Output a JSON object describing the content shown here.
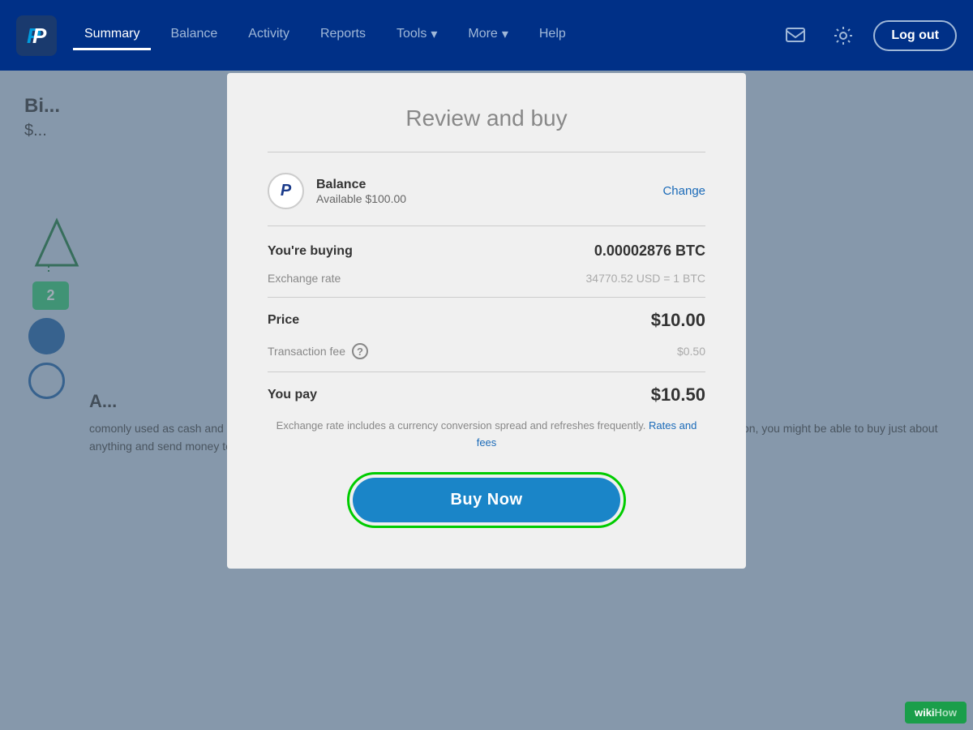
{
  "navbar": {
    "logo_alt": "PayPal Logo",
    "nav_items": [
      {
        "id": "summary",
        "label": "Summary",
        "active": true
      },
      {
        "id": "balance",
        "label": "Balance",
        "active": false
      },
      {
        "id": "activity",
        "label": "Activity",
        "active": false
      },
      {
        "id": "reports",
        "label": "Reports",
        "active": false
      },
      {
        "id": "tools",
        "label": "Tools",
        "active": false,
        "has_dropdown": true
      },
      {
        "id": "more",
        "label": "More",
        "active": false,
        "has_dropdown": true
      },
      {
        "id": "help",
        "label": "Help",
        "active": false
      }
    ],
    "logout_label": "Log out",
    "message_icon": "message-icon",
    "settings_icon": "gear-icon"
  },
  "background": {
    "page_title": "Bi...",
    "page_price": "$...",
    "badge_number": "2",
    "body_text": "comonly used as cash and credit. It set off a revolution that has since inspired thousands of variations on the original. Someday soon, you might be able to buy just about anything and send money to anyone using bitcoins and other"
  },
  "modal": {
    "title": "Review and buy",
    "payment_method": {
      "name": "Balance",
      "available": "Available $100.00",
      "change_label": "Change"
    },
    "rows": {
      "buying_label": "You're buying",
      "buying_value": "0.00002876 BTC",
      "exchange_rate_label": "Exchange rate",
      "exchange_rate_value": "34770.52 USD = 1 BTC",
      "price_label": "Price",
      "price_value": "$10.00",
      "transaction_fee_label": "Transaction fee",
      "transaction_fee_value": "$0.50",
      "you_pay_label": "You pay",
      "you_pay_value": "$10.50"
    },
    "footer_note": "Exchange rate includes a currency conversion spread and refreshes frequently.",
    "rates_fees_link": "Rates and fees",
    "buy_now_label": "Buy Now"
  },
  "wikihow": {
    "wiki_part": "wiki",
    "how_part": "How"
  }
}
